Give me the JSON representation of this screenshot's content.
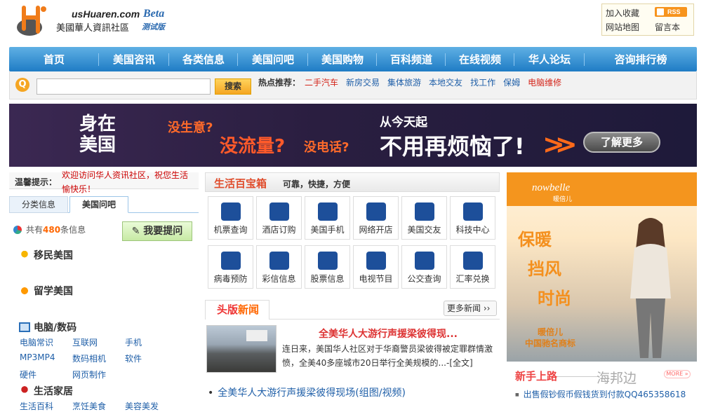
{
  "header": {
    "domain": "usHuaren.com",
    "site_name": "美國華人資訊社區",
    "beta": "Beta",
    "test_version": "测试版",
    "top_links": [
      "加入收藏",
      "网站地图",
      "留言本"
    ],
    "rss": "RSS"
  },
  "nav": {
    "items": [
      "首页",
      "美国咨讯",
      "各类信息",
      "美国问吧",
      "美国购物",
      "百科频道",
      "在线视频",
      "华人论坛",
      "咨询排行榜"
    ]
  },
  "search": {
    "button": "搜索",
    "hot_label": "热点推荐：",
    "hot_links": [
      {
        "label": "二手汽车",
        "color": "#d4251a"
      },
      {
        "label": "新房交易",
        "color": "#1f5fa8"
      },
      {
        "label": "集体旅游",
        "color": "#1f5fa8"
      },
      {
        "label": "本地交友",
        "color": "#1f5fa8"
      },
      {
        "label": "找工作",
        "color": "#1f5fa8"
      },
      {
        "label": "保姆",
        "color": "#1f5fa8"
      },
      {
        "label": "电脑维修",
        "color": "#d4251a"
      }
    ]
  },
  "banner": {
    "t1": "身在美国",
    "t2": "没生意?",
    "t3": "没流量?",
    "t4": "没电话?",
    "t5": "从今天起",
    "t6": "不用再烦恼了!",
    "cta": "了解更多"
  },
  "left": {
    "tip_label": "温馨提示：",
    "tip_text": "欢迎访问华人资讯社区，祝您生活愉快乐！",
    "tabs": [
      "分类信息",
      "美国问吧"
    ],
    "count_prefix": "共有",
    "count": "480",
    "count_suffix": "条信息",
    "ask_button": "我要提问",
    "categories": [
      {
        "title": "移民美国",
        "links": []
      },
      {
        "title": "留学美国",
        "links": []
      },
      {
        "title": "电脑/数码",
        "links": [
          "电脑常识",
          "互联网",
          "手机",
          "MP3MP4",
          "数码相机",
          "软件",
          "硬件",
          "网页制作"
        ]
      },
      {
        "title": "生活家居",
        "links": [
          "生活百科",
          "烹饪美食",
          "美容美发"
        ]
      }
    ]
  },
  "mid": {
    "title": "生活百宝箱",
    "subtitle": "可靠，快捷，方便",
    "grid": [
      {
        "label": "机票查询",
        "icon": "plane-icon"
      },
      {
        "label": "酒店订购",
        "icon": "building-icon"
      },
      {
        "label": "美国手机",
        "icon": "phone-icon"
      },
      {
        "label": "网络开店",
        "icon": "monitor-icon"
      },
      {
        "label": "美国交友",
        "icon": "people-icon"
      },
      {
        "label": "科技中心",
        "icon": "antenna-icon"
      },
      {
        "label": "病毒预防",
        "icon": "medical-cross-icon"
      },
      {
        "label": "彩信信息",
        "icon": "card-icon"
      },
      {
        "label": "股票信息",
        "icon": "chart-screen-icon"
      },
      {
        "label": "电视节目",
        "icon": "tv-icon"
      },
      {
        "label": "公交查询",
        "icon": "bus-icon"
      },
      {
        "label": "汇率兑换",
        "icon": "scale-icon"
      }
    ],
    "news_title_a": "头版",
    "news_title_b": "新闻",
    "more": "更多新闻 ››",
    "headline": "全美华人大游行声援梁彼得现...",
    "summary": "连日来，美国华人社区对于华裔警员梁彼得被定罪群情激愤，全美40多座城市20日举行全美规模的...-[全文]",
    "bullet": "全美华人大游行声援梁彼得现场(组图/视频)"
  },
  "ad": {
    "brand": "nowbelle",
    "brand_cn": "暖倍儿",
    "words": [
      "保暖",
      "挡风",
      "时尚"
    ],
    "slogan1": "暖倍儿",
    "slogan2": "中国驰名商标"
  },
  "newbie": {
    "title": "新手上路",
    "watermark": "海邦边",
    "more": "MORE »",
    "link": "出售假钞假币假钱货到付款QQ465358618"
  }
}
